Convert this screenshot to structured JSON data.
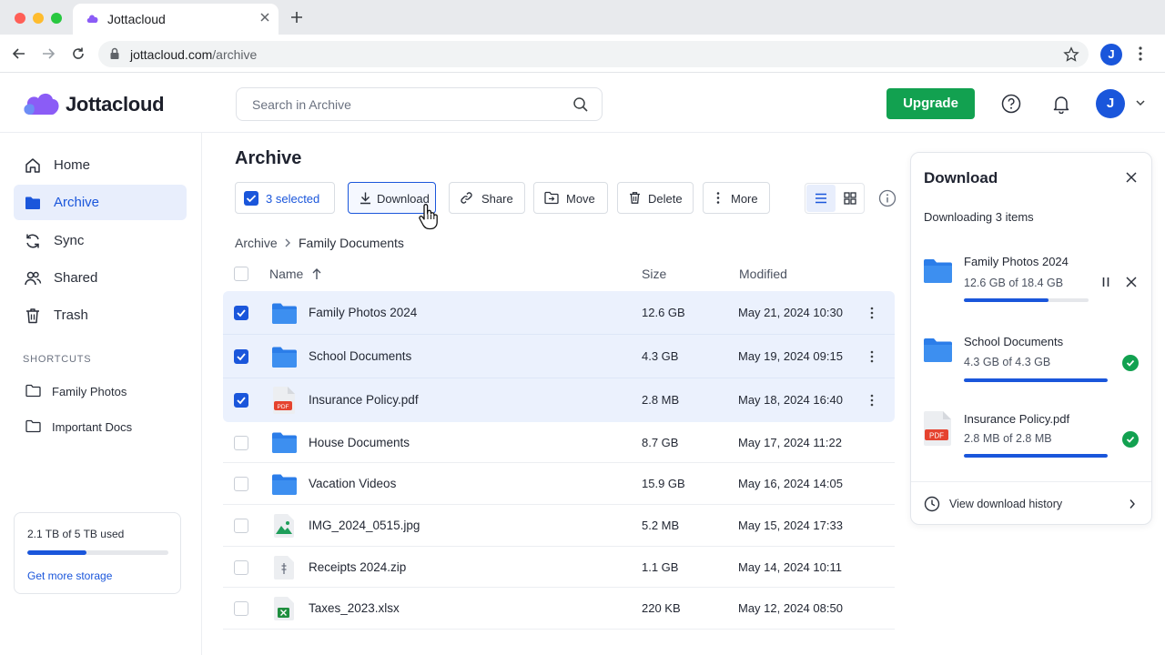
{
  "browser": {
    "tab_title": "Jottacloud",
    "url_host": "jottacloud.com",
    "url_path": "/archive",
    "profile_initial": "J"
  },
  "header": {
    "logo_text": "Jottacloud",
    "search_placeholder": "Search in Archive",
    "upgrade_label": "Upgrade",
    "user_initial": "J"
  },
  "sidebar": {
    "items": [
      {
        "label": "Home",
        "icon": "home-icon"
      },
      {
        "label": "Archive",
        "icon": "folder-icon",
        "active": true
      },
      {
        "label": "Sync",
        "icon": "sync-icon"
      },
      {
        "label": "Shared",
        "icon": "users-icon"
      },
      {
        "label": "Trash",
        "icon": "trash-icon"
      }
    ],
    "shortcuts_title": "SHORTCUTS",
    "shortcuts": [
      {
        "label": "Family Photos"
      },
      {
        "label": "Important Docs"
      }
    ],
    "storage": {
      "text": "2.1 TB of 5 TB used",
      "used_fraction": 0.42,
      "link": "Get more storage"
    }
  },
  "main": {
    "title": "Archive",
    "toolbar": {
      "selected_label": "3 selected",
      "download": "Download",
      "share": "Share",
      "move": "Move",
      "delete": "Delete",
      "more": "More"
    },
    "breadcrumb": {
      "root": "Archive",
      "current": "Family Documents"
    },
    "columns": {
      "name": "Name",
      "size": "Size",
      "modified": "Modified"
    },
    "rows": [
      {
        "name": "Family Photos 2024",
        "size": "12.6 GB",
        "modified": "May 21, 2024 10:30",
        "type": "folder",
        "selected": true
      },
      {
        "name": "School Documents",
        "size": "4.3 GB",
        "modified": "May 19, 2024 09:15",
        "type": "folder",
        "selected": true
      },
      {
        "name": "Insurance Policy.pdf",
        "size": "2.8 MB",
        "modified": "May 18, 2024 16:40",
        "type": "pdf",
        "selected": true
      },
      {
        "name": "House Documents",
        "size": "8.7 GB",
        "modified": "May 17, 2024 11:22",
        "type": "folder",
        "selected": false
      },
      {
        "name": "Vacation Videos",
        "size": "15.9 GB",
        "modified": "May 16, 2024 14:05",
        "type": "folder",
        "selected": false
      },
      {
        "name": "IMG_2024_0515.jpg",
        "size": "5.2 MB",
        "modified": "May 15, 2024 17:33",
        "type": "image",
        "selected": false
      },
      {
        "name": "Receipts 2024.zip",
        "size": "1.1 GB",
        "modified": "May 14, 2024 10:11",
        "type": "zip",
        "selected": false
      },
      {
        "name": "Taxes_2023.xlsx",
        "size": "220 KB",
        "modified": "May 12, 2024 08:50",
        "type": "xlsx",
        "selected": false
      }
    ]
  },
  "download_panel": {
    "title": "Download",
    "subtitle": "Downloading 3 items",
    "items": [
      {
        "name": "Family Photos 2024",
        "progress_text": "12.6 GB of 18.4 GB",
        "progress": 0.68,
        "status": "downloading",
        "type": "folder"
      },
      {
        "name": "School Documents",
        "progress_text": "4.3 GB of 4.3 GB",
        "progress": 1.0,
        "status": "complete",
        "type": "folder"
      },
      {
        "name": "Insurance Policy.pdf",
        "progress_text": "2.8 MB of 2.8 MB",
        "progress": 1.0,
        "status": "complete",
        "type": "pdf"
      }
    ],
    "history_link": "View download history"
  },
  "colors": {
    "accent": "#1a56db",
    "upgrade_green": "#12a150",
    "selected_row": "#ebf1fd",
    "pdf_red": "#e5432f",
    "xlsx_green": "#1e8e3e"
  }
}
